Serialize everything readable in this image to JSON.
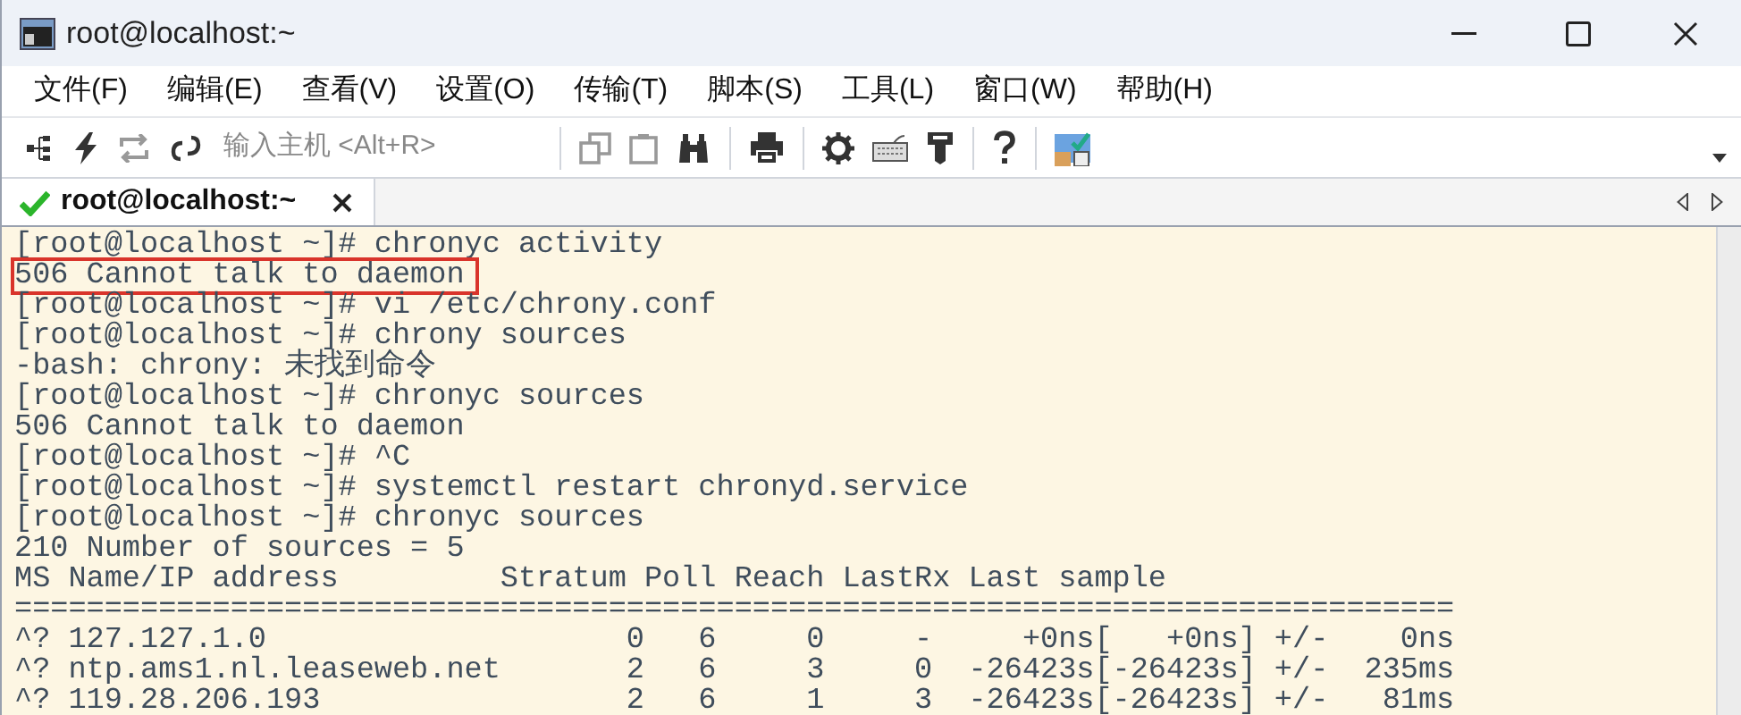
{
  "window": {
    "title": "root@localhost:~"
  },
  "menu": [
    "文件(F)",
    "编辑(E)",
    "查看(V)",
    "设置(O)",
    "传输(T)",
    "脚本(S)",
    "工具(L)",
    "窗口(W)",
    "帮助(H)"
  ],
  "toolbar": {
    "host_field": {
      "placeholder": "输入主机 <Alt+R>"
    }
  },
  "tabs": [
    {
      "label": "root@localhost:~",
      "selected": true,
      "connected": true
    }
  ],
  "terminal": {
    "lines": [
      {
        "text": "[root@localhost ~]# chronyc activity",
        "highlighted": false
      },
      {
        "text": "506 Cannot talk to daemon",
        "highlighted": true
      },
      {
        "text": "[root@localhost ~]# vi /etc/chrony.conf",
        "highlighted": false
      },
      {
        "text": "[root@localhost ~]# chrony sources",
        "highlighted": false
      },
      {
        "text": "-bash: chrony: 未找到命令",
        "highlighted": false
      },
      {
        "text": "[root@localhost ~]# chronyc sources",
        "highlighted": false
      },
      {
        "text": "506 Cannot talk to daemon",
        "highlighted": false
      },
      {
        "text": "[root@localhost ~]# ^C",
        "highlighted": false
      },
      {
        "text": "[root@localhost ~]# systemctl restart chronyd.service",
        "highlighted": false
      },
      {
        "text": "[root@localhost ~]# chronyc sources",
        "highlighted": false
      },
      {
        "text": "210 Number of sources = 5",
        "highlighted": false
      },
      {
        "text": "MS Name/IP address         Stratum Poll Reach LastRx Last sample",
        "highlighted": false
      },
      {
        "text": "================================================================================",
        "highlighted": false
      },
      {
        "text": "^? 127.127.1.0                    0   6     0     -     +0ns[   +0ns] +/-    0ns",
        "highlighted": false
      },
      {
        "text": "^? ntp.ams1.nl.leaseweb.net       2   6     3     0  -26423s[-26423s] +/-  235ms",
        "highlighted": false
      },
      {
        "text": "^? 119.28.206.193                 2   6     1     3  -26423s[-26423s] +/-   81ms",
        "highlighted": false
      }
    ]
  }
}
